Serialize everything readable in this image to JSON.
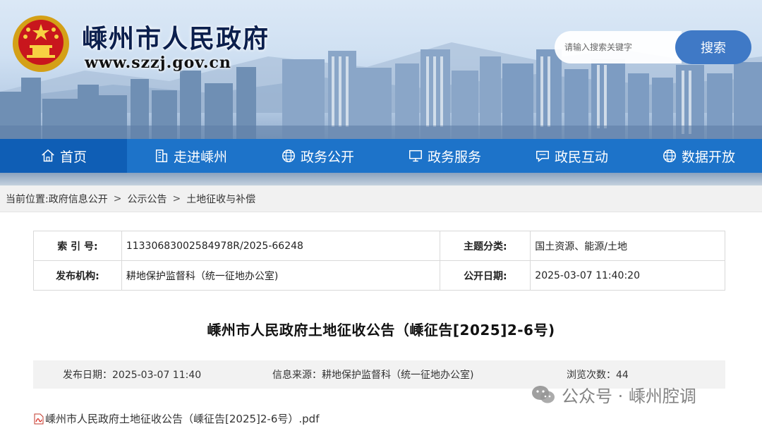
{
  "header": {
    "site_title": "嵊州市人民政府",
    "site_url": "www.szzj.gov.cn",
    "emblem_icon": "national-emblem-icon"
  },
  "search": {
    "placeholder": "请输入搜索关键字",
    "button_label": "搜索"
  },
  "nav": {
    "items": [
      {
        "label": "首页",
        "icon": "home-icon"
      },
      {
        "label": "走进嵊州",
        "icon": "building-icon"
      },
      {
        "label": "政务公开",
        "icon": "globe-icon"
      },
      {
        "label": "政务服务",
        "icon": "monitor-icon"
      },
      {
        "label": "政民互动",
        "icon": "chat-icon"
      },
      {
        "label": "数据开放",
        "icon": "globe-icon"
      }
    ],
    "active_index": 0
  },
  "breadcrumb": {
    "prefix": "当前位置:",
    "items": [
      "政府信息公开",
      "公示公告",
      "土地征收与补偿"
    ],
    "separator": ">"
  },
  "meta": {
    "index_label": "索 引 号:",
    "index_value": "11330683002584978R/2025-66248",
    "category_label": "主题分类:",
    "category_value": "国土资源、能源/土地",
    "publisher_label": "发布机构:",
    "publisher_value": "耕地保护监督科（统一征地办公室)",
    "date_label": "公开日期:",
    "date_value": "2025-03-07 11:40:20"
  },
  "article": {
    "title": "嵊州市人民政府土地征收公告（嵊征告[2025]2-6号)",
    "publish_date": "发布日期：2025-03-07 11:40",
    "source": "信息来源：耕地保护监督科（统一征地办公室)",
    "views": "浏览次数：44",
    "attachment": "嵊州市人民政府土地征收公告（嵊征告[2025]2-6号）.pdf"
  },
  "watermark": {
    "text": "公众号 · 嵊州腔调",
    "icon": "wechat-icon"
  },
  "colors": {
    "nav_bg": "#1d73c9",
    "nav_active": "#0f5eb5",
    "search_button": "#3f79c6",
    "title_text": "#0b1f4d"
  }
}
